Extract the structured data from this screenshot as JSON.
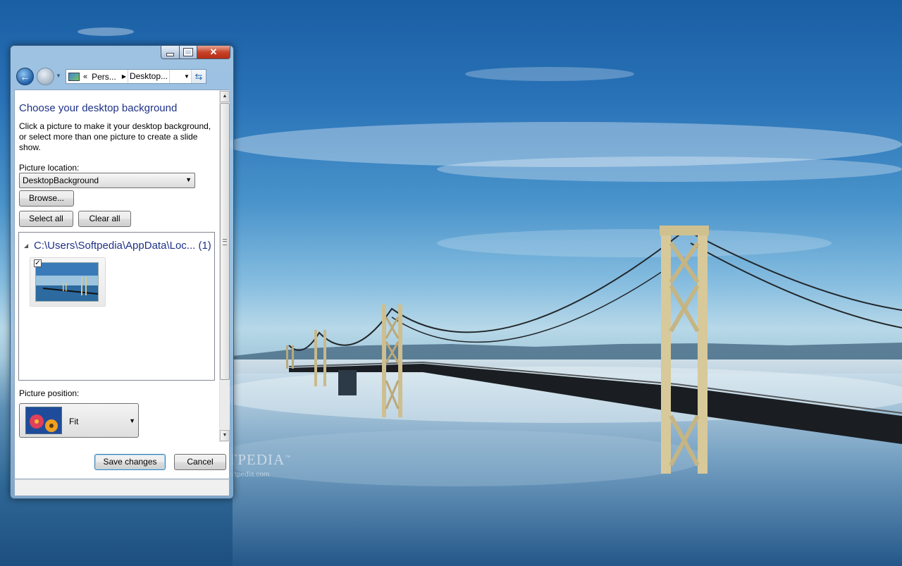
{
  "wallpaper": {
    "watermark": "SOFTPEDIA",
    "watermark_tm": "™",
    "watermark_url": "www.softpedia.com"
  },
  "window": {
    "caption_buttons": {
      "minimize_icon": "minimize-icon",
      "maximize_icon": "maximize-icon",
      "close_icon": "close-icon"
    },
    "nav": {
      "back_icon": "back-arrow-icon",
      "forward_icon": "forward-arrow-icon",
      "breadcrumb_overflow": "«",
      "segment_1": "Pers...",
      "segment_2": "Desktop...",
      "refresh_icon": "refresh-icon"
    },
    "heading": "Choose your desktop background",
    "description": "Click a picture to make it your desktop background, or select more than one picture to create a slide show.",
    "picture_location_label": "Picture location:",
    "picture_location_value": "DesktopBackground",
    "browse_label": "Browse...",
    "select_all_label": "Select all",
    "clear_all_label": "Clear all",
    "gallery": {
      "group_header": "C:\\Users\\Softpedia\\AppData\\Loc... (1)",
      "thumbnails": [
        {
          "checked": true,
          "name": "bay-bridge-fog"
        }
      ]
    },
    "picture_position_label": "Picture position:",
    "picture_position_value": "Fit",
    "save_label": "Save changes",
    "cancel_label": "Cancel"
  }
}
